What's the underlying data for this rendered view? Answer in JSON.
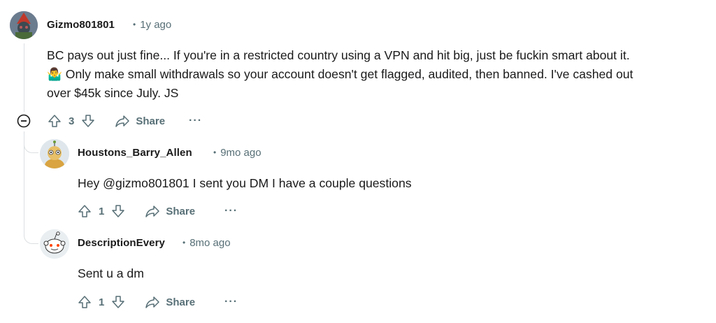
{
  "comments": [
    {
      "username": "Gizmo801801",
      "time": "1y ago",
      "body_lines": [
        "BC pays out just fine... If you're in a restricted country using a VPN and hit big, just be fuckin smart about it.",
        "🤷‍♂️ Only make small withdrawals so your account doesn't get flagged, audited, then banned. I've cashed out",
        "over $45k since July. JS"
      ],
      "votes": "3",
      "share_label": "Share",
      "more_label": "···"
    },
    {
      "username": "Houstons_Barry_Allen",
      "time": "9mo ago",
      "body_lines": [
        "Hey @gizmo801801 I sent you DM I have a couple questions"
      ],
      "votes": "1",
      "share_label": "Share",
      "more_label": "···"
    },
    {
      "username": "DescriptionEvery",
      "time": "8mo ago",
      "body_lines": [
        "Sent u a dm"
      ],
      "votes": "1",
      "share_label": "Share",
      "more_label": "···"
    }
  ],
  "meta_separator": "•",
  "colors": {
    "text": "#1a1a1b",
    "meta": "#576f76",
    "thread_line": "#dcdfe1"
  }
}
